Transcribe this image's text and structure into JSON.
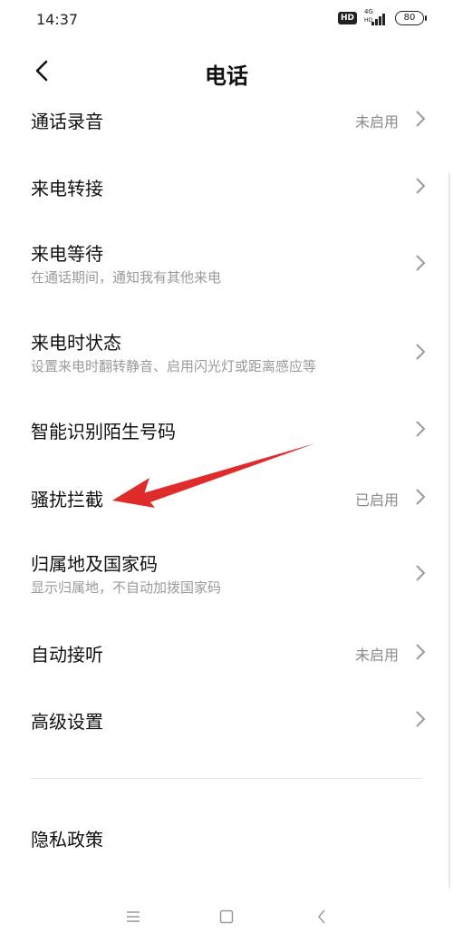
{
  "status_bar": {
    "time": "14:37",
    "hd_badge": "HD",
    "network_type": "4G",
    "signal_sub": "HD",
    "battery": "80",
    "icons": [
      "hd-icon",
      "signal-icon",
      "battery-icon"
    ]
  },
  "header": {
    "title": "电话",
    "back_icon": "chevron-left-icon"
  },
  "settings": [
    {
      "label": "通话录音",
      "status": "未启用"
    },
    {
      "label": "来电转接"
    },
    {
      "label": "来电等待",
      "sub": "在通话期间，通知我有其他来电"
    },
    {
      "label": "来电时状态",
      "sub": "设置来电时翻转静音、启用闪光灯或距离感应等"
    },
    {
      "label": "智能识别陌生号码"
    },
    {
      "label": "骚扰拦截",
      "status": "已启用"
    },
    {
      "label": "归属地及国家码",
      "sub": "显示归属地，不自动加拨国家码"
    },
    {
      "label": "自动接听",
      "status": "未启用"
    },
    {
      "label": "高级设置"
    }
  ],
  "privacy": {
    "label": "隐私政策"
  },
  "annotation": {
    "arrow_color": "#e02b2b",
    "points_to": "骚扰拦截"
  },
  "nav_bar": {
    "icons": [
      "menu-icon",
      "home-icon",
      "back-icon"
    ]
  },
  "colors": {
    "accent_arrow": "#e02b2b",
    "secondary_text": "#9a9a9a",
    "status_text": "#8a8a8a"
  }
}
